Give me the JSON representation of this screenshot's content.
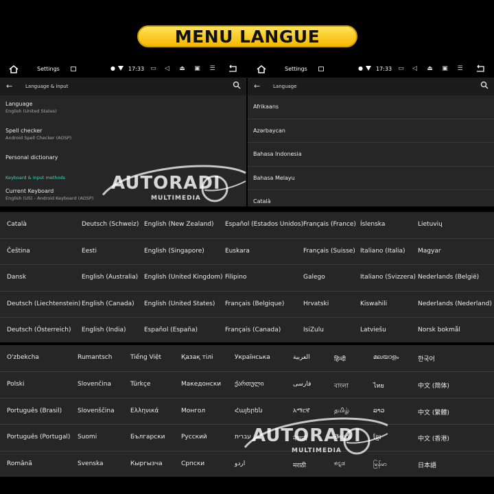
{
  "banner": {
    "title": "MENU LANGUE"
  },
  "left_screen": {
    "status": {
      "title": "Settings",
      "time": "17:33"
    },
    "toolbar": {
      "title": "Language & input"
    },
    "prefs": {
      "language": {
        "title": "Language",
        "summary": "English (United States)"
      },
      "spell": {
        "title": "Spell checker",
        "summary": "Android Spell Checker (AOSP)"
      },
      "dictionary": {
        "title": "Personal dictionary"
      },
      "category": "Keyboard & input methods",
      "keyboard": {
        "title": "Current Keyboard",
        "summary": "English (US) - Android Keyboard (AOSP)"
      }
    }
  },
  "right_screen": {
    "status": {
      "title": "Settings",
      "time": "17:33"
    },
    "toolbar": {
      "title": "Language"
    },
    "languages": [
      "Afrikaans",
      "Azərbaycan",
      "Bahasa Indonesia",
      "Bahasa Melayu",
      "Català"
    ]
  },
  "grid1": [
    [
      "Català",
      "Deutsch (Schweiz)",
      "English (New Zealand)",
      "Español (Estados Unidos)",
      "Français (France)",
      "Íslenska",
      "Lietuvių"
    ],
    [
      "Čeština",
      "Eesti",
      "English (Singapore)",
      "Euskara",
      "Français (Suisse)",
      "Italiano (Italia)",
      "Magyar"
    ],
    [
      "Dansk",
      "English (Australia)",
      "English (United Kingdom)",
      "Filipino",
      "Galego",
      "Italiano (Svizzera)",
      "Nederlands (België)"
    ],
    [
      "Deutsch (Liechtenstein)",
      "English (Canada)",
      "English (United States)",
      "Français (Belgique)",
      "Hrvatski",
      "Kiswahili",
      "Nederlands (Nederland)"
    ],
    [
      "Deutsch (Österreich)",
      "English (India)",
      "Español (España)",
      "Français (Canada)",
      "IsiZulu",
      "Latviešu",
      "Norsk bokmål"
    ]
  ],
  "grid2": [
    [
      "O'zbekcha",
      "Rumantsch",
      "Tiếng Việt",
      "Қазақ тілі",
      "Українська",
      "العربية",
      "हिन्दी",
      "മലയാളം",
      "한국어"
    ],
    [
      "Polski",
      "Slovenčina",
      "Türkçe",
      "Македонски",
      "ქართული",
      "فارسی",
      "বাংলা",
      "ไทย",
      "中文 (简体)"
    ],
    [
      "Português (Brasil)",
      "Slovenščina",
      "Ελληνικά",
      "Монгол",
      "Հայերեն",
      "አማርኛ",
      "தமிழ்",
      "ລາວ",
      "中文 (繁體)"
    ],
    [
      "Português (Portugal)",
      "Suomi",
      "Български",
      "Русский",
      "עברית",
      "नेपाली",
      "తెలుగు",
      "ខ្មែរ",
      "中文 (香港)"
    ],
    [
      "Română",
      "Svenska",
      "Кыргызча",
      "Српски",
      "اردو",
      "मराठी",
      "ಕನ್ನಡ",
      " မြန်မာ",
      "日本語"
    ]
  ],
  "watermark": {
    "brand": "AUTORADI",
    "sub": "MULTIMEDIA"
  },
  "colors": {
    "banner": "#f5c400",
    "category_accent": "#5fd1b4",
    "panel": "#262626"
  }
}
